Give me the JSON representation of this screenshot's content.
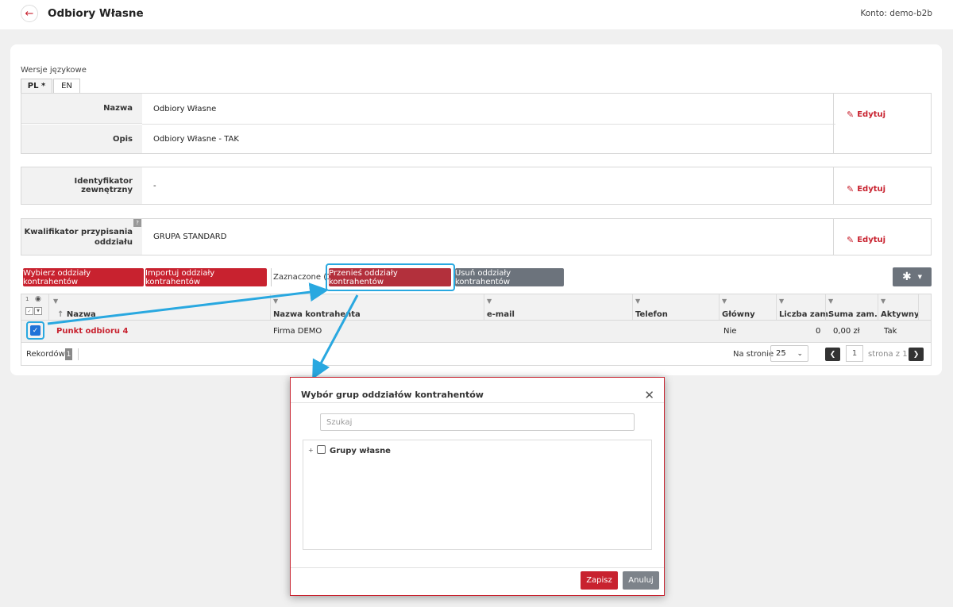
{
  "header": {
    "title": "Odbiory Własne",
    "account": "Konto: demo-b2b"
  },
  "languages": {
    "label": "Wersje językowe",
    "tabs": [
      "PL *",
      "EN"
    ]
  },
  "fields": {
    "nazwa_label": "Nazwa",
    "nazwa_value": "Odbiory Własne",
    "opis_label": "Opis",
    "opis_value": "Odbiory Własne - TAK",
    "ext_id_label": "Identyfikator zewnętrzny",
    "ext_id_value": "-",
    "qualifier_label": "Kwalifikator przypisania oddziału",
    "qualifier_value": "GRUPA STANDARD",
    "help": "?"
  },
  "edit_label": "Edytuj",
  "toolbar": {
    "select_branches": "Wybierz oddziały kontrahentów",
    "import_branches": "Importuj oddziały kontrahentów",
    "selected": "Zaznaczone (1)",
    "move_branches": "Przenieś oddziały kontrahentów",
    "delete_branches": "Usuń oddziały kontrahentów"
  },
  "table": {
    "count_indicator": "1",
    "columns": [
      "Nazwa",
      "Nazwa kontrahenta",
      "e-mail",
      "Telefon",
      "Główny",
      "Liczba zam.",
      "Suma zam.",
      "Aktywny"
    ],
    "rows": [
      {
        "name": "Punkt odbioru 4",
        "contractor": "Firma DEMO",
        "email": "",
        "phone": "",
        "main": "Nie",
        "order_count": "0",
        "order_sum": "0,00 zł",
        "active": "Tak",
        "checked": true
      }
    ],
    "records_label": "Rekordów:",
    "records_count": "1",
    "per_page_label": "Na stronie",
    "per_page": "25",
    "page": "1",
    "page_of": "strona z 1"
  },
  "modal": {
    "title": "Wybór grup oddziałów kontrahentów",
    "search_placeholder": "Szukaj",
    "tree_item": "Grupy własne",
    "save": "Zapisz",
    "cancel": "Anuluj"
  },
  "colors": {
    "accent": "#c8222f",
    "grey_button": "#6c737c",
    "highlight": "#29a8e0"
  }
}
